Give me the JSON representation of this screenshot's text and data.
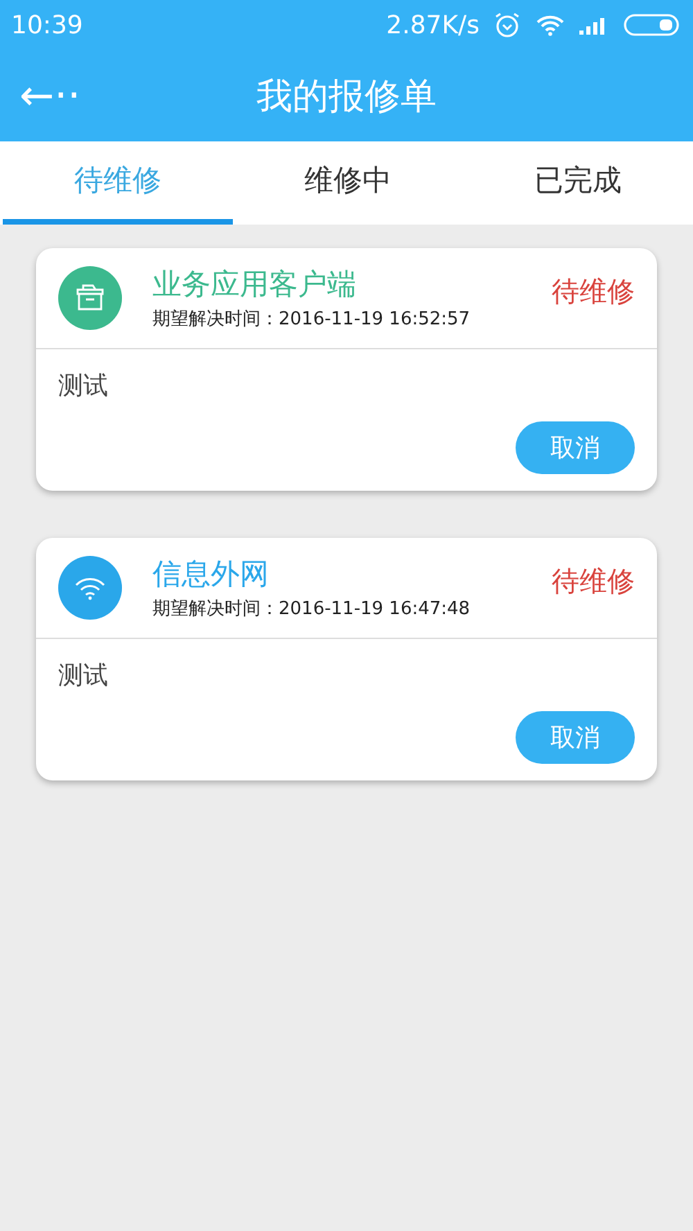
{
  "status_bar": {
    "time": "10:39",
    "speed": "2.87K/s"
  },
  "header": {
    "back": "←··",
    "title": "我的报修单"
  },
  "tabs": [
    {
      "label": "待维修",
      "selected": true
    },
    {
      "label": "维修中",
      "selected": false
    },
    {
      "label": "已完成",
      "selected": false
    }
  ],
  "orders": [
    {
      "kind": "box",
      "color": "#3cb98e",
      "title": "业务应用客户端",
      "time": "期望解决时间：2016-11-19 16:52:57",
      "status": "待维修",
      "description": "测试",
      "action": "取消"
    },
    {
      "kind": "wifi",
      "color": "#2aa7ea",
      "title": "信息外网",
      "time": "期望解决时间：2016-11-19 16:47:48",
      "status": "待维修",
      "description": "测试",
      "action": "取消"
    }
  ]
}
